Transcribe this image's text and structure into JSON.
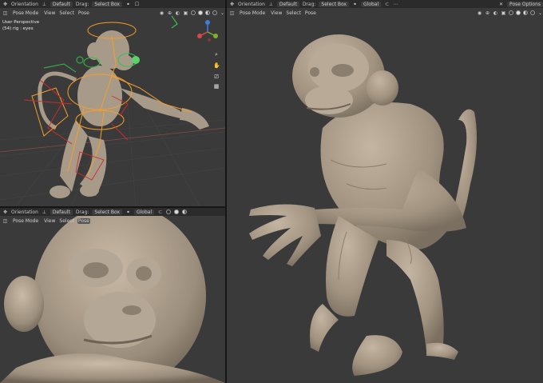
{
  "header": {
    "mode": "Pose Mode",
    "orientation_label": "Orientation",
    "orientation_value": "Default",
    "drag_label": "Drag:",
    "drag_value": "Select Box",
    "transform_space": "Global",
    "pose_options": "Pose Options"
  },
  "menu": {
    "view": "View",
    "select": "Select",
    "pose": "Pose"
  },
  "viewport_tl": {
    "perspective": "User Perspective",
    "object_info": "(54) rig : eyes"
  },
  "axes": {
    "x": "X",
    "y": "Y",
    "z": "Z"
  },
  "colors": {
    "viewport_bg": "#3a3a3a",
    "header_bg": "#2b2b2b",
    "monkey_skin": "#a89a88",
    "bone_orange": "#f59e2a",
    "bone_red": "#d32a2a",
    "bone_green": "#34c24a"
  },
  "icons": [
    "hand-icon",
    "camera-icon",
    "zoom-icon",
    "grid-icon",
    "eye-icon"
  ]
}
